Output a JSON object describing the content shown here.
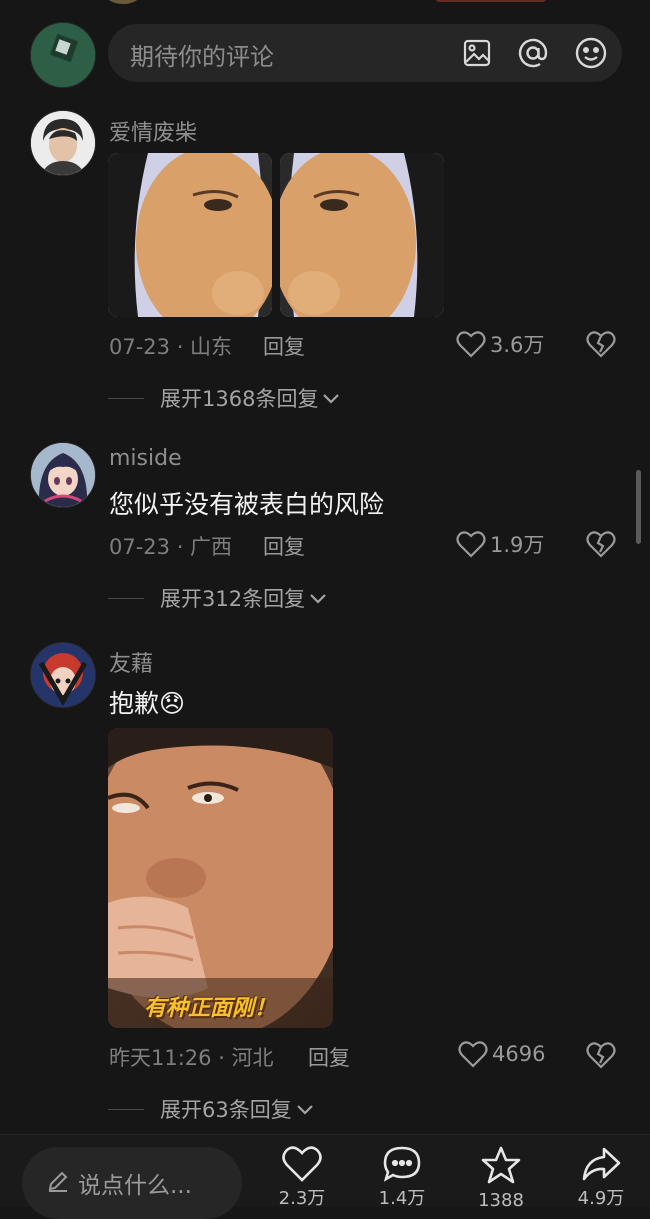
{
  "composer": {
    "placeholder": "期待你的评论",
    "image_icon": "image-icon",
    "mention_icon": "at-icon",
    "emoji_icon": "emoji-icon"
  },
  "comments": [
    {
      "username": "爱情废柴",
      "text": "",
      "date_location": "07-23 · 山东",
      "reply_label": "回复",
      "likes": "3.6万",
      "expand_label": "展开1368条回复"
    },
    {
      "username": "miside",
      "text": "您似乎没有被表白的风险",
      "date_location": "07-23 · 广西",
      "reply_label": "回复",
      "likes": "1.9万",
      "expand_label": "展开312条回复"
    },
    {
      "username": "友藉",
      "text": "抱歉😞",
      "image_caption": "有种正面刚！",
      "date_location": "昨天11:26 · 河北",
      "reply_label": "回复",
      "likes": "4696",
      "expand_label": "展开63条回复"
    }
  ],
  "bottom_bar": {
    "say_placeholder": "说点什么...",
    "like_count": "2.3万",
    "comment_count": "1.4万",
    "favorite_count": "1388",
    "share_count": "4.9万"
  },
  "colors": {
    "background": "#161616",
    "text_primary": "#f2f2f2",
    "text_muted": "#8a8a8a"
  }
}
